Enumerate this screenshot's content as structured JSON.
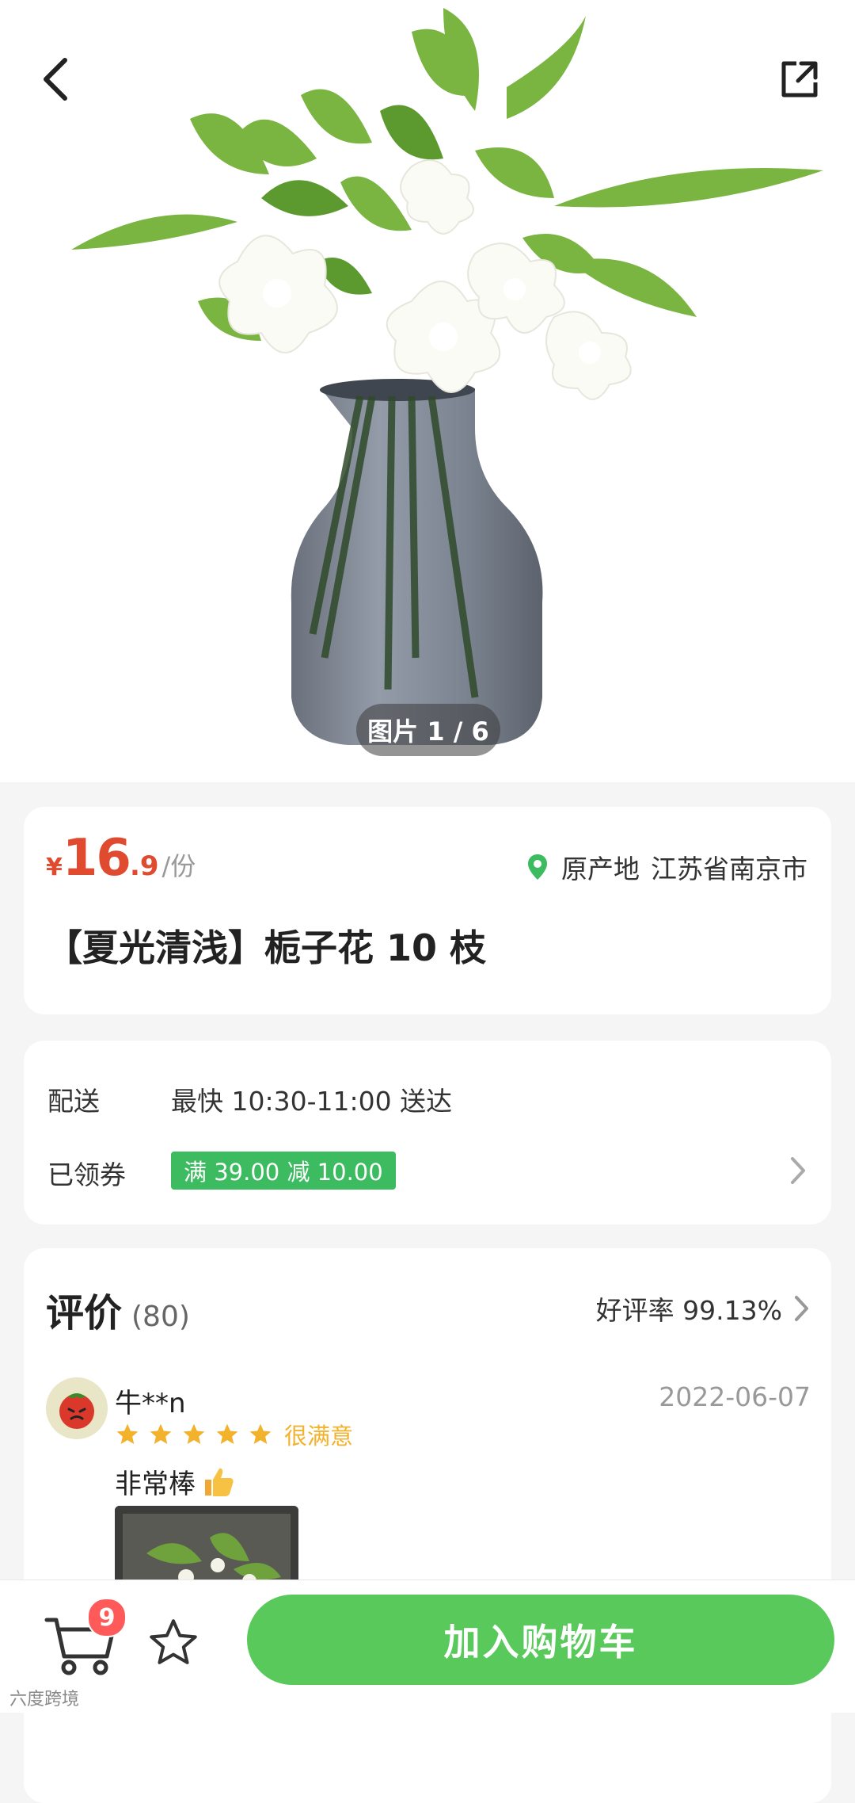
{
  "nav": {
    "back_icon": "back-arrow-icon",
    "share_icon": "share-icon"
  },
  "gallery": {
    "counter": "图片 1 / 6"
  },
  "product": {
    "currency": "¥",
    "price_int": "16",
    "price_dec": ".9",
    "unit": "/份",
    "origin_label": "原产地",
    "origin_value": "江苏省南京市",
    "title": "【夏光清浅】栀子花 10 枝"
  },
  "delivery": {
    "label": "配送",
    "value": "最快 10:30-11:00 送达",
    "coupon_label": "已领券",
    "coupon_text": "满 39.00 减 10.00"
  },
  "reviews": {
    "title": "评价",
    "count": "(80)",
    "rating_text": "好评率 99.13%",
    "items": [
      {
        "user": "牛**n",
        "date": "2022-06-07",
        "stars": 5,
        "stars_text": "很满意",
        "comment": "非常棒"
      }
    ]
  },
  "bottom": {
    "cart_count": "9",
    "add_to_cart": "加入购物车"
  },
  "watermark": "六度跨境",
  "colors": {
    "price": "#e04a2f",
    "accent_green": "#58c95a",
    "coupon_green": "#3dbb60",
    "star": "#f2b22c",
    "badge": "#ff5a5a"
  }
}
